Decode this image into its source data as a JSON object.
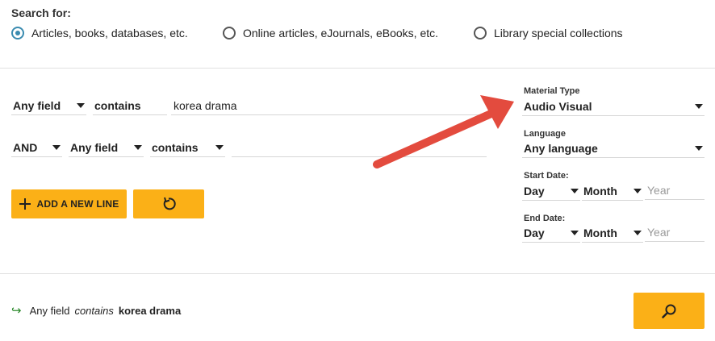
{
  "search_for": {
    "label": "Search for:",
    "options": [
      {
        "label": "Articles, books, databases, etc.",
        "checked": true
      },
      {
        "label": "Online articles, eJournals, eBooks, etc.",
        "checked": false
      },
      {
        "label": "Library special collections",
        "checked": false
      }
    ]
  },
  "query": {
    "line1": {
      "field": "Any field",
      "operator": "contains",
      "value": "korea drama"
    },
    "line2": {
      "boolean": "AND",
      "field": "Any field",
      "operator": "contains",
      "value": ""
    }
  },
  "buttons": {
    "add_line": "ADD A NEW LINE",
    "add_icon": "plus-icon",
    "reset_icon": "reset-icon",
    "search_icon": "search-icon"
  },
  "filters": {
    "material_type": {
      "label": "Material Type",
      "value": "Audio Visual"
    },
    "language": {
      "label": "Language",
      "value": "Any language"
    },
    "start_date": {
      "label": "Start Date:",
      "day": "Day",
      "month": "Month",
      "year_placeholder": "Year"
    },
    "end_date": {
      "label": "End Date:",
      "day": "Day",
      "month": "Month",
      "year_placeholder": "Year"
    }
  },
  "summary": {
    "field": "Any field",
    "operator": "contains",
    "value": "korea drama"
  },
  "colors": {
    "accent": "#fbb017",
    "radio": "#3a8bb0",
    "annotation_arrow": "#e34b3e"
  }
}
